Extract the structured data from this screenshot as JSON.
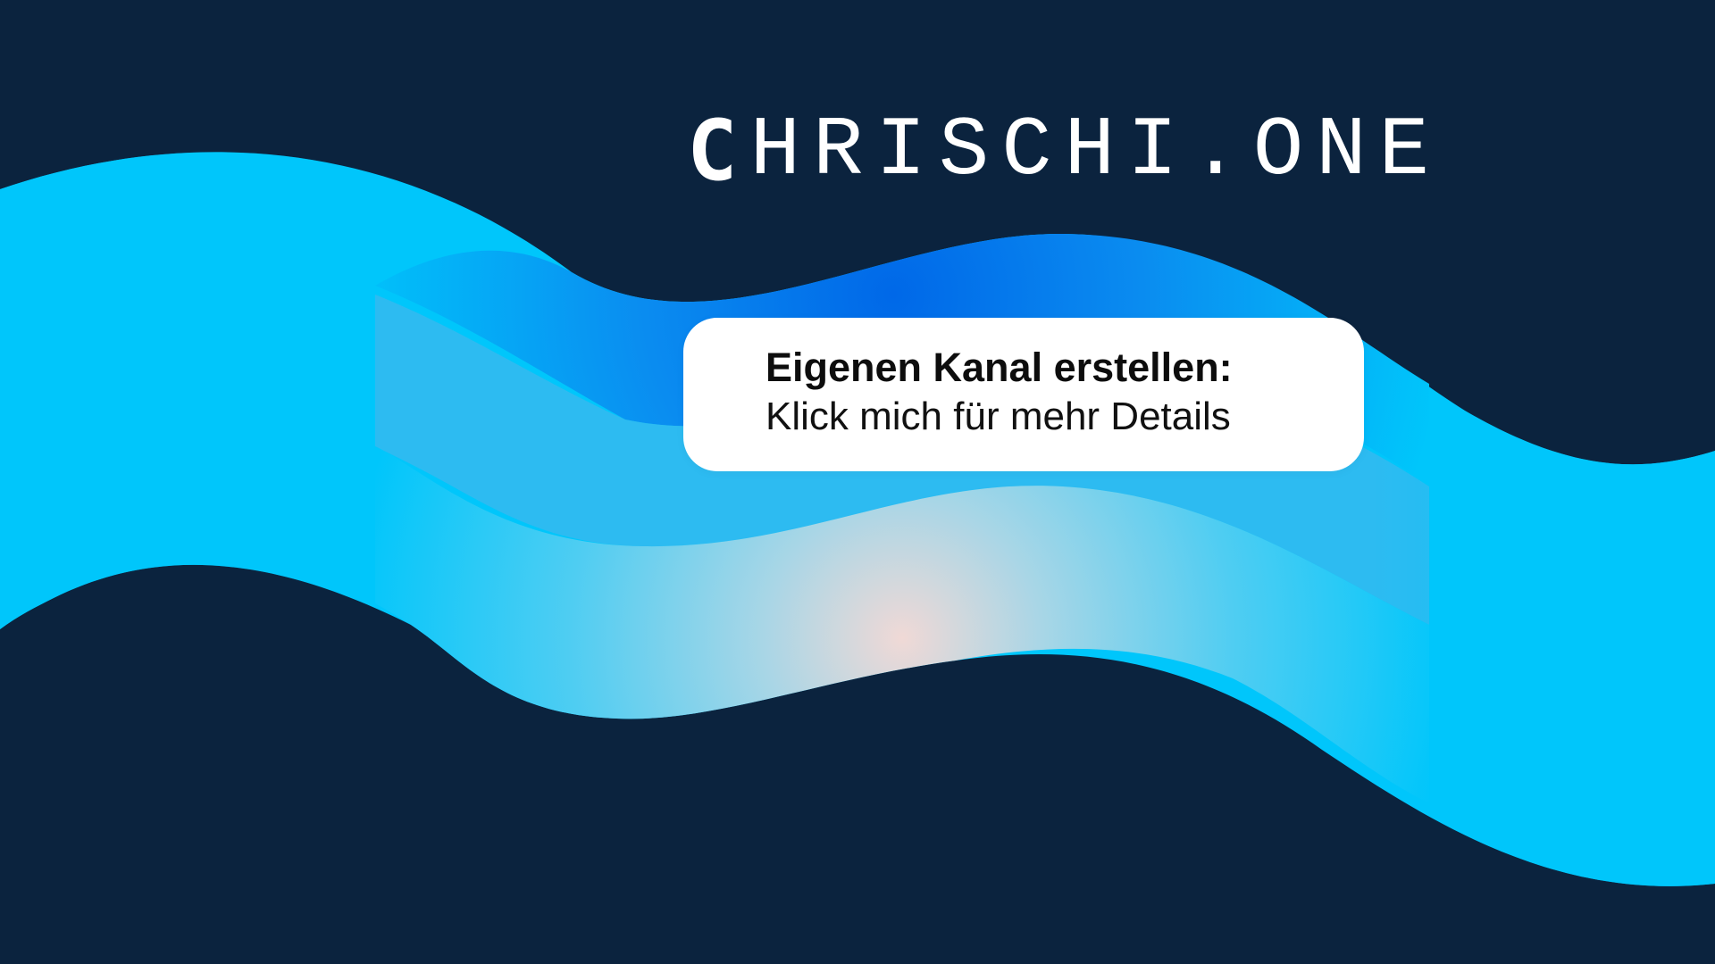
{
  "brand": {
    "logo_first_letter": "C",
    "logo_rest": "HRISCHI.ONE"
  },
  "cta": {
    "title": "Eigenen Kanal erstellen:",
    "subtitle": "Klick mich für mehr Details"
  },
  "colors": {
    "background": "#0b233e",
    "wave_cyan": "#00c6fb",
    "wave_blue": "#0073e6",
    "wave_light": "#6fd2ee",
    "wave_glow": "#f2dcd8",
    "card": "#ffffff",
    "logo": "#ffffff"
  }
}
